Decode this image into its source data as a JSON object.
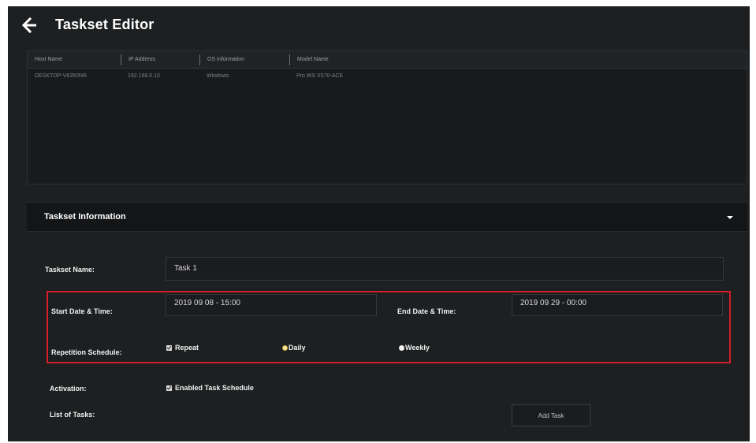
{
  "header": {
    "title": "Taskset Editor",
    "back_icon": "arrow-left-icon"
  },
  "hosts": {
    "columns": [
      "Host Name",
      "IP Address",
      "OS Information",
      "Model Name"
    ],
    "rows": [
      [
        "DESKTOP-V6350NR",
        "192.168.0.10",
        "Windows",
        "Pro WS X570-ACE"
      ]
    ]
  },
  "taskset": {
    "section_title": "Taskset Information",
    "name_label": "Taskset Name:",
    "name_value": "Task 1",
    "start_label": "Start Date & Time:",
    "start_value": "2019 09 08 - 15:00",
    "end_label": "End Date & Time:",
    "end_value": "2019 09 29 - 00:00",
    "repetition_label": "Repetition Schedule:",
    "repeat_label": "Repeat",
    "repeat_checked": true,
    "daily_label": "Daily",
    "daily_selected": true,
    "weekly_label": "Weekly",
    "activation_label": "Activation:",
    "enabled_label": "Enabled Task Schedule",
    "enabled_checked": true,
    "tasks_label": "List of Tasks:",
    "add_task_label": "Add Task"
  },
  "colors": {
    "highlight": "#d21f2a",
    "background": "#1d1f21"
  }
}
